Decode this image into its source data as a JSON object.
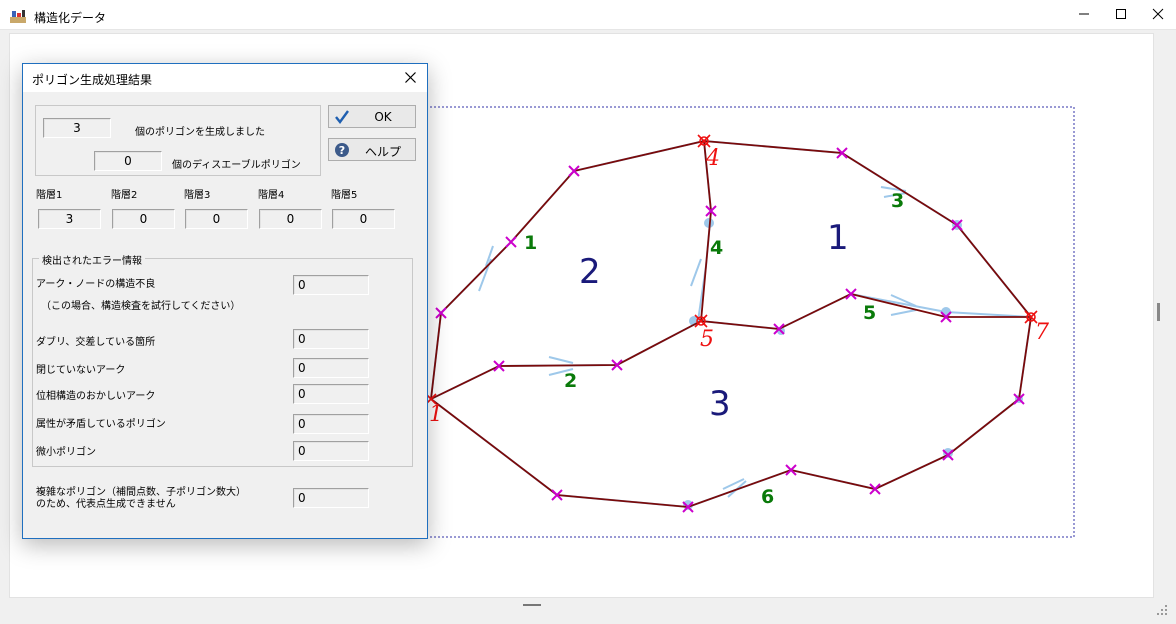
{
  "window": {
    "title": "構造化データ"
  },
  "dialog": {
    "title": "ポリゴン生成処理結果",
    "summary": {
      "polygon_count": "3",
      "polygon_count_label": "個のポリゴンを生成しました",
      "disabled_count": "0",
      "disabled_label": "個のディスエーブルポリゴン"
    },
    "buttons": {
      "ok": "OK",
      "help": "ヘルプ"
    },
    "layers": [
      {
        "label": "階層1",
        "value": "3"
      },
      {
        "label": "階層2",
        "value": "0"
      },
      {
        "label": "階層3",
        "value": "0"
      },
      {
        "label": "階層4",
        "value": "0"
      },
      {
        "label": "階層5",
        "value": "0"
      }
    ],
    "errors": {
      "group_label": "検出されたエラー情報",
      "arc_node_label": "アーク・ノードの構造不良",
      "arc_node_note": "（この場合、構造検査を試行してください）",
      "arc_node_value": "0",
      "duplicate_label": "ダブリ、交差している箇所",
      "duplicate_value": "0",
      "unclosed_label": "閉じていないアーク",
      "unclosed_value": "0",
      "topology_label": "位相構造のおかしいアーク",
      "topology_value": "0",
      "attribute_label": "属性が矛盾しているポリゴン",
      "attribute_value": "0",
      "tiny_label": "微小ポリゴン",
      "tiny_value": "0"
    },
    "complex": {
      "label_line1": "複雑なポリゴン（補間点数、子ポリゴン数大）",
      "label_line2": "のため、代表点生成できません",
      "value": "0"
    }
  },
  "map": {
    "colors": {
      "arc": "#7a0a0a",
      "vertex": "#cc00cc",
      "node": "#ee1111",
      "arc_label": "#0a7a0a",
      "polygon_label": "#1a1a7a",
      "guide": "#9ec8ea"
    },
    "polygon_labels": [
      "1",
      "2",
      "3"
    ],
    "arc_labels": [
      "1",
      "2",
      "3",
      "4",
      "5",
      "6"
    ],
    "node_labels": [
      "1",
      "4",
      "5",
      "7"
    ]
  }
}
